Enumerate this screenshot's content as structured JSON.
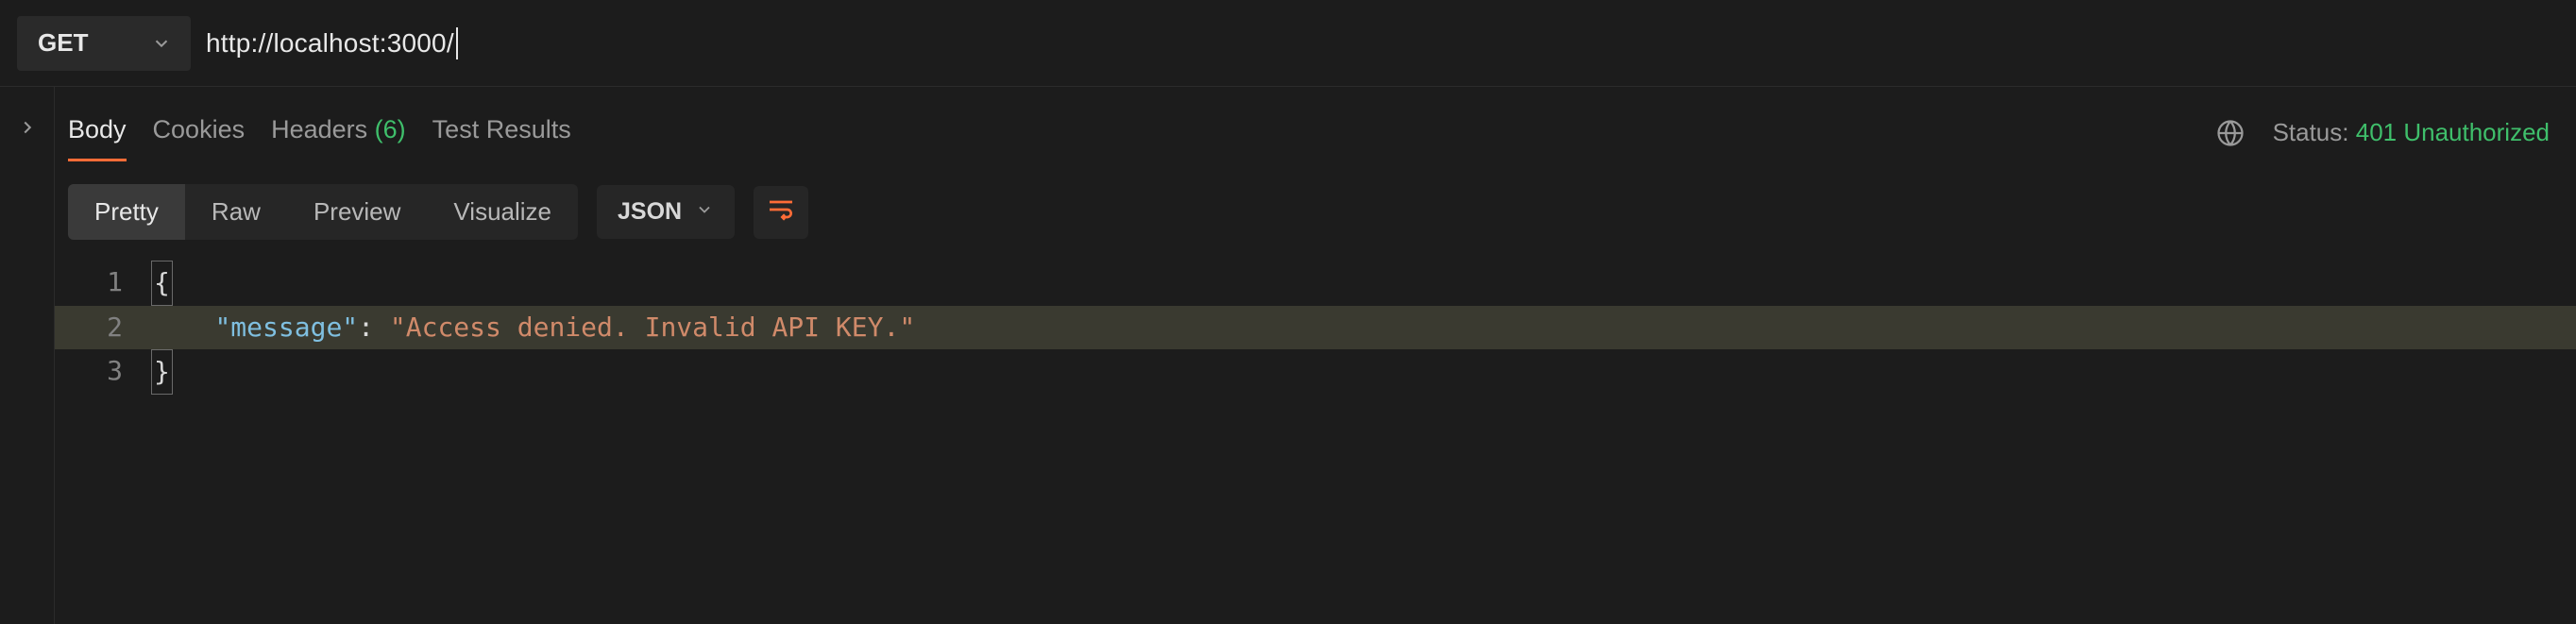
{
  "request": {
    "method": "GET",
    "url": "http://localhost:3000/"
  },
  "response_tabs": {
    "body": "Body",
    "cookies": "Cookies",
    "headers": "Headers",
    "headers_count": "(6)",
    "test_results": "Test Results"
  },
  "status": {
    "label": "Status:",
    "value": "401 Unauthorized"
  },
  "view_modes": {
    "pretty": "Pretty",
    "raw": "Raw",
    "preview": "Preview",
    "visualize": "Visualize"
  },
  "format_select": "JSON",
  "code": {
    "line1_num": "1",
    "line1_brace": "{",
    "line2_num": "2",
    "line2_indent": "    ",
    "line2_key": "\"message\"",
    "line2_colon": ": ",
    "line2_val": "\"Access denied. Invalid API KEY.\"",
    "line3_num": "3",
    "line3_brace": "}"
  }
}
